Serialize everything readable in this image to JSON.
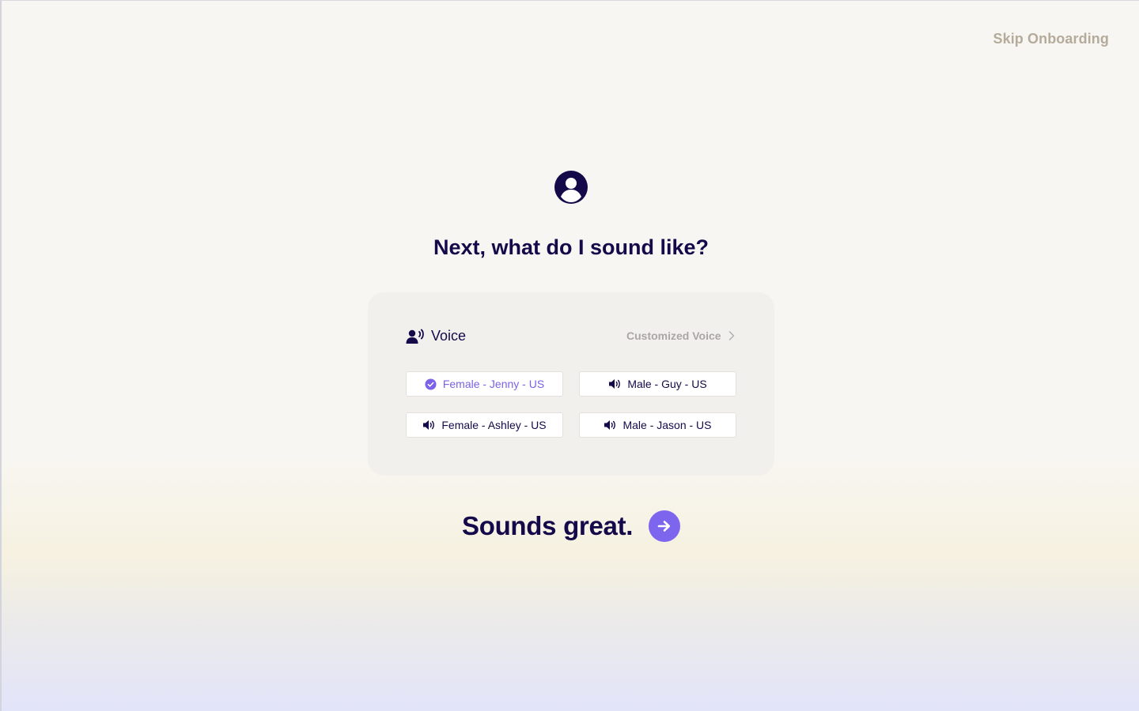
{
  "header": {
    "skip_label": "Skip Onboarding"
  },
  "main": {
    "title": "Next, what do I sound like?",
    "icon": "user-circle-icon"
  },
  "voice_card": {
    "label": "Voice",
    "icon": "voice-speaker-icon",
    "custom_link_label": "Customized Voice",
    "options": [
      {
        "label": "Female - Jenny - US",
        "selected": true,
        "icon": "check-circle-icon"
      },
      {
        "label": "Male - Guy - US",
        "selected": false,
        "icon": "speaker-icon"
      },
      {
        "label": "Female - Ashley - US",
        "selected": false,
        "icon": "speaker-icon"
      },
      {
        "label": "Male - Jason - US",
        "selected": false,
        "icon": "speaker-icon"
      }
    ]
  },
  "cta": {
    "label": "Sounds great.",
    "icon": "arrow-right-icon"
  },
  "colors": {
    "primary_text": "#140a4a",
    "accent": "#7d65ee",
    "muted": "#b5ab9a"
  }
}
